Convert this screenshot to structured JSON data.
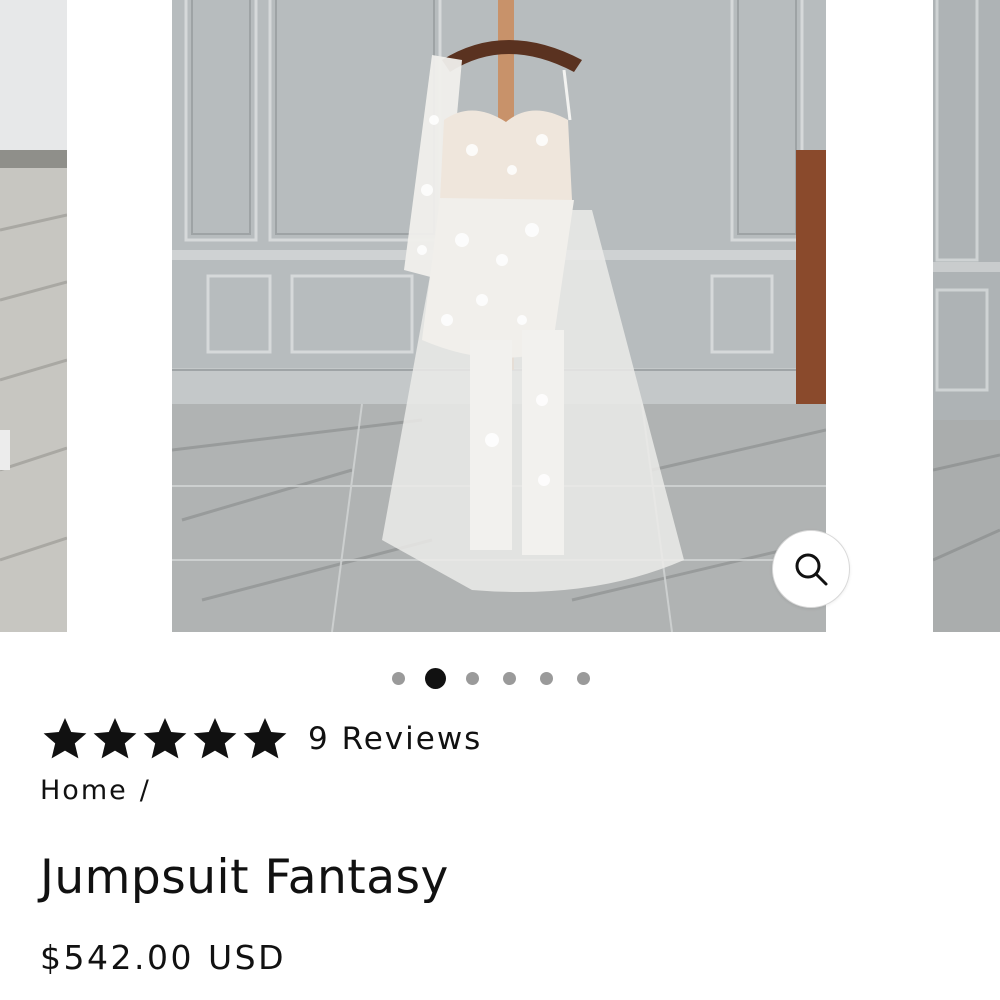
{
  "gallery": {
    "main_image_alt": "Jumpsuit Fantasy",
    "zoom_icon": "search-icon",
    "slide_count": 6,
    "active_slide": 2
  },
  "rating": {
    "stars": 5,
    "max_stars": 5,
    "review_count_label": "9 Reviews"
  },
  "breadcrumb": {
    "home_label": "Home",
    "separator": "/"
  },
  "product": {
    "title": "Jumpsuit Fantasy",
    "price": "$542.00",
    "currency": "USD"
  },
  "colors": {
    "text": "#111111",
    "dot_inactive": "#9a9a9a",
    "dot_active": "#111111"
  }
}
